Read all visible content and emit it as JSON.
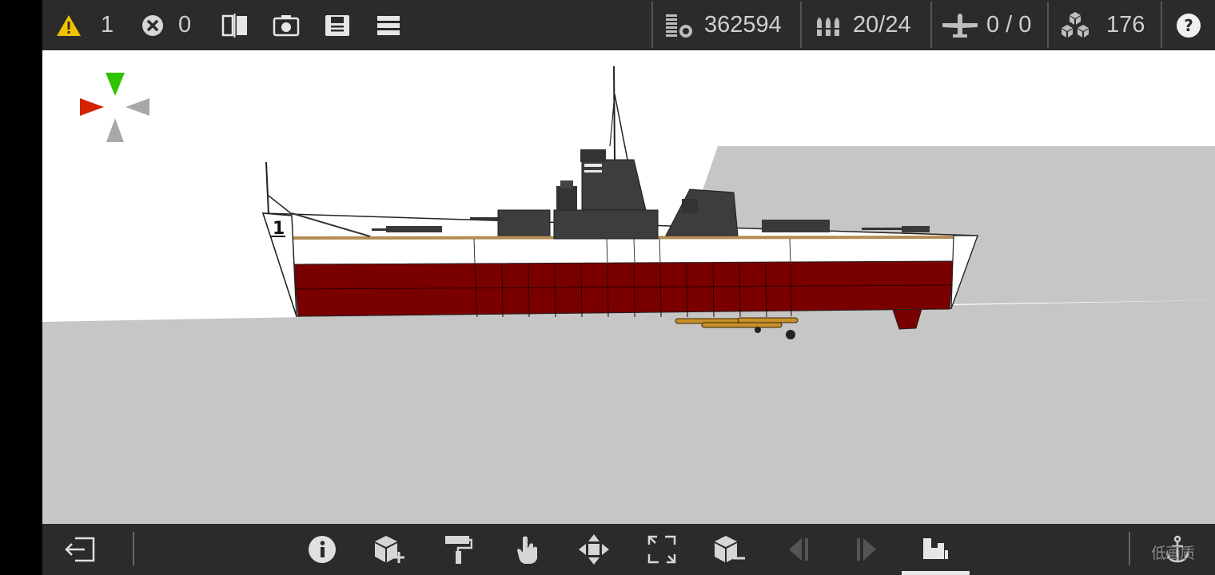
{
  "topbar": {
    "warnings": {
      "count": "1",
      "icon": "warning-icon",
      "color": "#f2c200"
    },
    "errors": {
      "count": "0",
      "icon": "error-icon"
    },
    "stats": {
      "cost": "362594",
      "weapons": "20/24",
      "aircraft": "0 / 0",
      "parts": "176"
    }
  },
  "bottombar": {
    "tools": [
      "exit-icon",
      "info-icon",
      "add-part-icon",
      "paint-roller-icon",
      "select-hand-icon",
      "move-icon",
      "resize-icon",
      "remove-part-icon",
      "prev-icon",
      "next-icon",
      "seat-view-icon",
      "anchor-icon"
    ],
    "quality_label": "低画质"
  },
  "colors": {
    "hull_red": "#7a0000",
    "hull_white": "#ffffff",
    "superstructure": "#3d3d3d",
    "sea": "#c6c6c6",
    "axis_green": "#2fc300",
    "axis_red": "#d42100",
    "axis_gray": "#a8a8a8"
  }
}
